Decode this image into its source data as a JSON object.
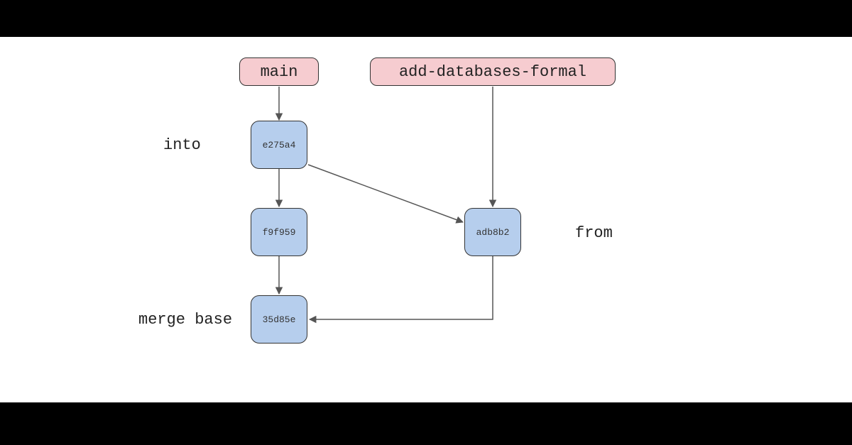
{
  "branches": {
    "main": "main",
    "feature": "add-databases-formal"
  },
  "commits": {
    "c1": "e275a4",
    "c2": "f9f959",
    "c3": "35d85e",
    "c4": "adb8b2"
  },
  "labels": {
    "into": "into",
    "from": "from",
    "merge_base": "merge base"
  },
  "colors": {
    "branch_fill": "#f6ccd0",
    "commit_fill": "#b6ceed",
    "stroke": "#333333"
  }
}
